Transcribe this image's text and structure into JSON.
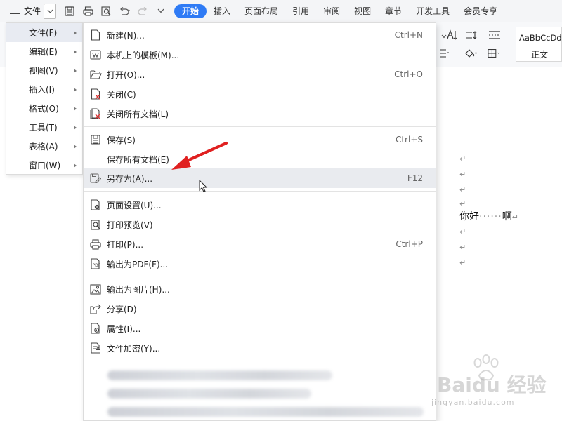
{
  "topbar": {
    "file_label": "文件",
    "tabs": [
      {
        "label": "开始",
        "active": true
      },
      {
        "label": "插入"
      },
      {
        "label": "页面布局"
      },
      {
        "label": "引用"
      },
      {
        "label": "审阅"
      },
      {
        "label": "视图"
      },
      {
        "label": "章节"
      },
      {
        "label": "开发工具"
      },
      {
        "label": "会员专享"
      }
    ]
  },
  "ribbon": {
    "style_sample": "AaBbCcDd",
    "style_name": "正文"
  },
  "main_menu": {
    "items": [
      {
        "label": "文件(F)",
        "active": true
      },
      {
        "label": "编辑(E)"
      },
      {
        "label": "视图(V)"
      },
      {
        "label": "插入(I)"
      },
      {
        "label": "格式(O)"
      },
      {
        "label": "工具(T)"
      },
      {
        "label": "表格(A)"
      },
      {
        "label": "窗口(W)"
      }
    ]
  },
  "file_submenu": {
    "items": [
      {
        "label": "新建(N)...",
        "shortcut": "Ctrl+N",
        "icon": "new-document-icon"
      },
      {
        "label": "本机上的模板(M)...",
        "shortcut": "",
        "icon": "template-icon"
      },
      {
        "label": "打开(O)...",
        "shortcut": "Ctrl+O",
        "icon": "folder-open-icon"
      },
      {
        "label": "关闭(C)",
        "shortcut": "",
        "icon": "close-document-icon"
      },
      {
        "label": "关闭所有文档(L)",
        "shortcut": "",
        "icon": "close-all-icon"
      },
      {
        "label": "保存(S)",
        "shortcut": "Ctrl+S",
        "icon": "save-icon"
      },
      {
        "label": "保存所有文档(E)",
        "shortcut": "",
        "icon": ""
      },
      {
        "label": "另存为(A)...",
        "shortcut": "F12",
        "icon": "save-as-icon",
        "hover": true
      },
      {
        "label": "页面设置(U)...",
        "shortcut": "",
        "icon": "page-setup-icon"
      },
      {
        "label": "打印预览(V)",
        "shortcut": "",
        "icon": "print-preview-icon"
      },
      {
        "label": "打印(P)...",
        "shortcut": "Ctrl+P",
        "icon": "printer-icon"
      },
      {
        "label": "输出为PDF(F)...",
        "shortcut": "",
        "icon": "pdf-icon"
      },
      {
        "label": "输出为图片(H)...",
        "shortcut": "",
        "icon": "image-export-icon"
      },
      {
        "label": "分享(D)",
        "shortcut": "",
        "icon": "share-icon"
      },
      {
        "label": "属性(I)...",
        "shortcut": "",
        "icon": "properties-icon"
      },
      {
        "label": "文件加密(Y)...",
        "shortcut": "",
        "icon": "encrypt-icon"
      }
    ]
  },
  "document": {
    "text_start": "你好",
    "text_end": "啊",
    "para_mark": "↵"
  },
  "watermark": {
    "brand": "Baidu 经验",
    "url": "jingyan.baidu.com"
  },
  "colors": {
    "accent": "#2f7bf5",
    "annotation_arrow": "#e02020",
    "menu_hover": "#e9ebef"
  }
}
